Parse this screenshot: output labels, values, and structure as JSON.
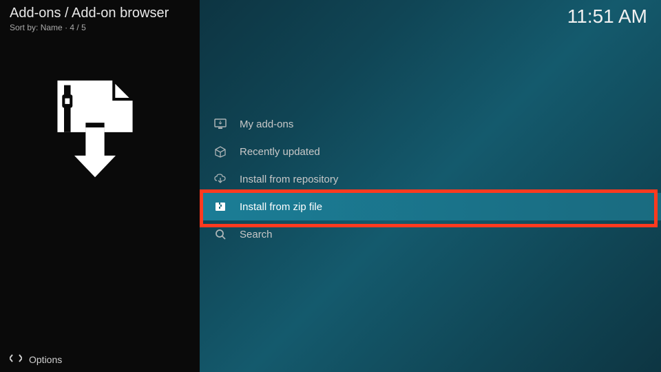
{
  "header": {
    "breadcrumb": "Add-ons / Add-on browser",
    "sort_label": "Sort by:",
    "sort_value": "Name",
    "position": "4 / 5"
  },
  "clock": "11:51 AM",
  "menu": {
    "items": [
      {
        "label": "My add-ons",
        "icon": "monitor"
      },
      {
        "label": "Recently updated",
        "icon": "box"
      },
      {
        "label": "Install from repository",
        "icon": "cloud-download"
      },
      {
        "label": "Install from zip file",
        "icon": "zip"
      },
      {
        "label": "Search",
        "icon": "search"
      }
    ],
    "selected_index": 3
  },
  "footer": {
    "options_label": "Options"
  }
}
